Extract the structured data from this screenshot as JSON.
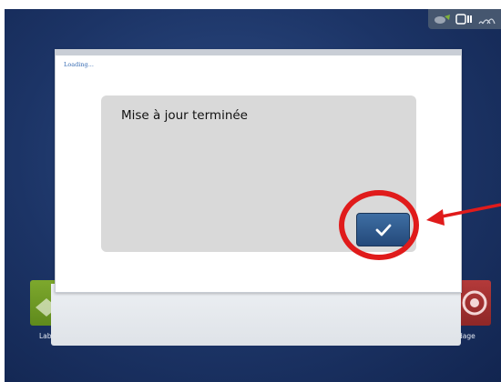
{
  "status_bar": {
    "icons": [
      "gps-receiver-icon",
      "display-icon",
      "wireless-signal-icon"
    ]
  },
  "home": {
    "left_app_label": "Lab",
    "right_app_label": "dage"
  },
  "dialog": {
    "loading_text": "Loading...",
    "message": "Mise à jour terminée",
    "ok_icon": "checkmark-icon"
  },
  "annotation": {
    "color": "#e01b1b",
    "circle": "highlight-ok-button",
    "arrow": "pointer-arrow"
  },
  "colors": {
    "background": "#1c3466",
    "dialog": "#ffffff",
    "message_box": "#d9d9d9",
    "ok_button": "#2f5a8c",
    "loading_text": "#3b6fb5"
  }
}
